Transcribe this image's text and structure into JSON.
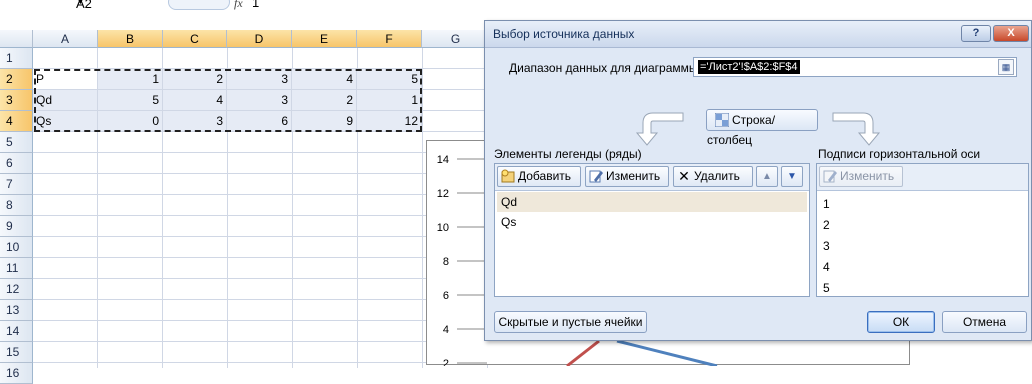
{
  "formula_bar": {
    "name_box": "A2",
    "fx": "fx",
    "value": "1"
  },
  "columns": [
    "A",
    "B",
    "C",
    "D",
    "E",
    "F",
    "G"
  ],
  "rows": [
    "1",
    "2",
    "3",
    "4",
    "5",
    "6",
    "7",
    "8",
    "9",
    "10",
    "11",
    "12",
    "13",
    "14",
    "15",
    "16"
  ],
  "sheet_rows": [
    {
      "label": "P",
      "values": [
        "1",
        "2",
        "3",
        "4",
        "5"
      ]
    },
    {
      "label": "Qd",
      "values": [
        "5",
        "4",
        "3",
        "2",
        "1"
      ]
    },
    {
      "label": "Qs",
      "values": [
        "0",
        "3",
        "6",
        "9",
        "12"
      ]
    }
  ],
  "chart": {
    "y_ticks": [
      "14",
      "12",
      "10",
      "8",
      "6",
      "4",
      "2"
    ],
    "colors": {
      "qd": "#c0504d",
      "qs": "#4f81bd"
    }
  },
  "dialog": {
    "title": "Выбор источника данных",
    "help": "?",
    "close": "X",
    "range_label": "Диапазон данных для диаграммы:",
    "range_value": "='Лист2'!$A$2:$F$4",
    "switch_label": "Строка/столбец",
    "legend_section": "Элементы легенды (ряды)",
    "axis_section": "Подписи горизонтальной оси (категории)",
    "legend_buttons": {
      "add": "Добавить",
      "edit": "Изменить",
      "delete": "Удалить"
    },
    "axis_buttons": {
      "edit": "Изменить"
    },
    "legend_items": [
      "Qd",
      "Qs"
    ],
    "axis_items": [
      "1",
      "2",
      "3",
      "4",
      "5"
    ],
    "hidden_cells": "Скрытые и пустые ячейки",
    "ok": "ОК",
    "cancel": "Отмена"
  }
}
